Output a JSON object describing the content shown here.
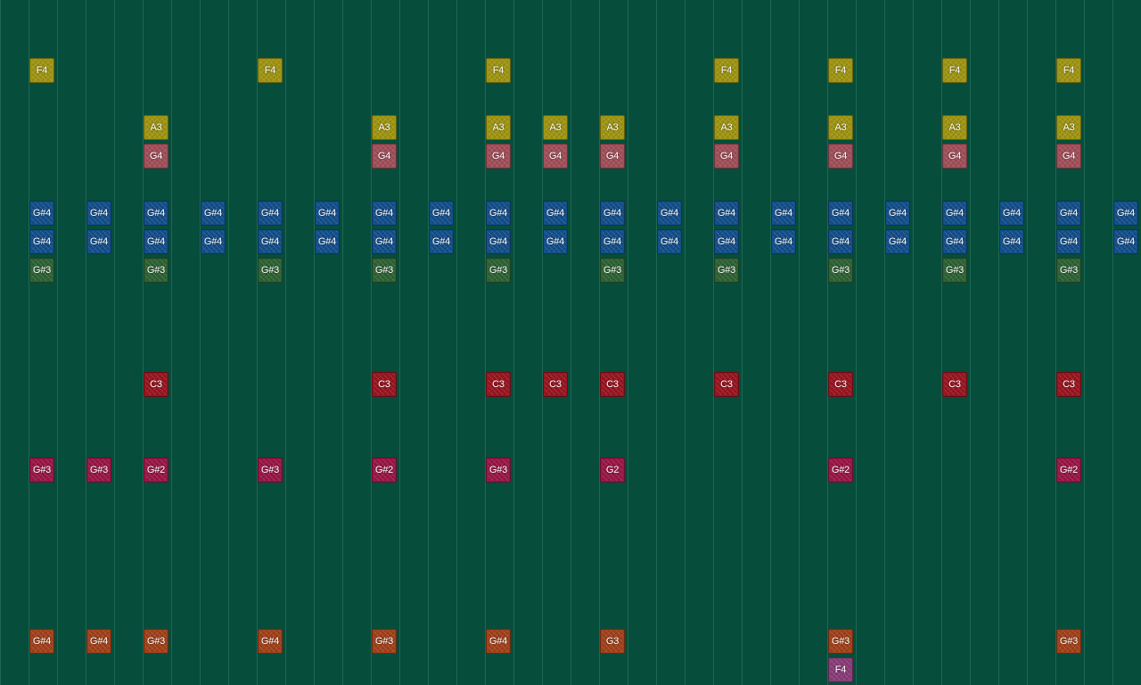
{
  "view": {
    "columns": 40,
    "track_colors": {
      "track_1": "#9f9512",
      "track_2": "#9f9512",
      "track_3": "#a24f59",
      "track_4": "#134f8b",
      "track_5": "#134f8b",
      "track_6": "#2d6334",
      "track_7": "#9a1520",
      "track_8": "#9b1646",
      "track_9": "#a2411a",
      "track_10": "#8a3c79"
    }
  },
  "notes": [
    {
      "label": "F4",
      "track": 1,
      "col": 1
    },
    {
      "label": "F4",
      "track": 1,
      "col": 9
    },
    {
      "label": "F4",
      "track": 1,
      "col": 17
    },
    {
      "label": "F4",
      "track": 1,
      "col": 25
    },
    {
      "label": "F4",
      "track": 1,
      "col": 29
    },
    {
      "label": "F4",
      "track": 1,
      "col": 33
    },
    {
      "label": "F4",
      "track": 1,
      "col": 37
    },
    {
      "label": "A3",
      "track": 2,
      "col": 5
    },
    {
      "label": "A3",
      "track": 2,
      "col": 13
    },
    {
      "label": "A3",
      "track": 2,
      "col": 17
    },
    {
      "label": "A3",
      "track": 2,
      "col": 19
    },
    {
      "label": "A3",
      "track": 2,
      "col": 21
    },
    {
      "label": "A3",
      "track": 2,
      "col": 25
    },
    {
      "label": "A3",
      "track": 2,
      "col": 29
    },
    {
      "label": "A3",
      "track": 2,
      "col": 33
    },
    {
      "label": "A3",
      "track": 2,
      "col": 37
    },
    {
      "label": "G4",
      "track": 3,
      "col": 5
    },
    {
      "label": "G4",
      "track": 3,
      "col": 13
    },
    {
      "label": "G4",
      "track": 3,
      "col": 17
    },
    {
      "label": "G4",
      "track": 3,
      "col": 19
    },
    {
      "label": "G4",
      "track": 3,
      "col": 21
    },
    {
      "label": "G4",
      "track": 3,
      "col": 25
    },
    {
      "label": "G4",
      "track": 3,
      "col": 29
    },
    {
      "label": "G4",
      "track": 3,
      "col": 33
    },
    {
      "label": "G4",
      "track": 3,
      "col": 37
    },
    {
      "label": "G#4",
      "track": 4,
      "col": 1
    },
    {
      "label": "G#4",
      "track": 4,
      "col": 3
    },
    {
      "label": "G#4",
      "track": 4,
      "col": 5
    },
    {
      "label": "G#4",
      "track": 4,
      "col": 7
    },
    {
      "label": "G#4",
      "track": 4,
      "col": 9
    },
    {
      "label": "G#4",
      "track": 4,
      "col": 11
    },
    {
      "label": "G#4",
      "track": 4,
      "col": 13
    },
    {
      "label": "G#4",
      "track": 4,
      "col": 15
    },
    {
      "label": "G#4",
      "track": 4,
      "col": 17
    },
    {
      "label": "G#4",
      "track": 4,
      "col": 19
    },
    {
      "label": "G#4",
      "track": 4,
      "col": 21
    },
    {
      "label": "G#4",
      "track": 4,
      "col": 23
    },
    {
      "label": "G#4",
      "track": 4,
      "col": 25
    },
    {
      "label": "G#4",
      "track": 4,
      "col": 27
    },
    {
      "label": "G#4",
      "track": 4,
      "col": 29
    },
    {
      "label": "G#4",
      "track": 4,
      "col": 31
    },
    {
      "label": "G#4",
      "track": 4,
      "col": 33
    },
    {
      "label": "G#4",
      "track": 4,
      "col": 35
    },
    {
      "label": "G#4",
      "track": 4,
      "col": 37
    },
    {
      "label": "G#4",
      "track": 4,
      "col": 39
    },
    {
      "label": "G#4",
      "track": 5,
      "col": 1
    },
    {
      "label": "G#4",
      "track": 5,
      "col": 3
    },
    {
      "label": "G#4",
      "track": 5,
      "col": 5
    },
    {
      "label": "G#4",
      "track": 5,
      "col": 7
    },
    {
      "label": "G#4",
      "track": 5,
      "col": 9
    },
    {
      "label": "G#4",
      "track": 5,
      "col": 11
    },
    {
      "label": "G#4",
      "track": 5,
      "col": 13
    },
    {
      "label": "G#4",
      "track": 5,
      "col": 15
    },
    {
      "label": "G#4",
      "track": 5,
      "col": 17
    },
    {
      "label": "G#4",
      "track": 5,
      "col": 19
    },
    {
      "label": "G#4",
      "track": 5,
      "col": 21
    },
    {
      "label": "G#4",
      "track": 5,
      "col": 23
    },
    {
      "label": "G#4",
      "track": 5,
      "col": 25
    },
    {
      "label": "G#4",
      "track": 5,
      "col": 27
    },
    {
      "label": "G#4",
      "track": 5,
      "col": 29
    },
    {
      "label": "G#4",
      "track": 5,
      "col": 31
    },
    {
      "label": "G#4",
      "track": 5,
      "col": 33
    },
    {
      "label": "G#4",
      "track": 5,
      "col": 35
    },
    {
      "label": "G#4",
      "track": 5,
      "col": 37
    },
    {
      "label": "G#4",
      "track": 5,
      "col": 39
    },
    {
      "label": "G#3",
      "track": 6,
      "col": 1
    },
    {
      "label": "G#3",
      "track": 6,
      "col": 5
    },
    {
      "label": "G#3",
      "track": 6,
      "col": 9
    },
    {
      "label": "G#3",
      "track": 6,
      "col": 13
    },
    {
      "label": "G#3",
      "track": 6,
      "col": 17
    },
    {
      "label": "G#3",
      "track": 6,
      "col": 21
    },
    {
      "label": "G#3",
      "track": 6,
      "col": 25
    },
    {
      "label": "G#3",
      "track": 6,
      "col": 29
    },
    {
      "label": "G#3",
      "track": 6,
      "col": 33
    },
    {
      "label": "G#3",
      "track": 6,
      "col": 37
    },
    {
      "label": "C3",
      "track": 7,
      "col": 5
    },
    {
      "label": "C3",
      "track": 7,
      "col": 13
    },
    {
      "label": "C3",
      "track": 7,
      "col": 17
    },
    {
      "label": "C3",
      "track": 7,
      "col": 19
    },
    {
      "label": "C3",
      "track": 7,
      "col": 21
    },
    {
      "label": "C3",
      "track": 7,
      "col": 25
    },
    {
      "label": "C3",
      "track": 7,
      "col": 29
    },
    {
      "label": "C3",
      "track": 7,
      "col": 33
    },
    {
      "label": "C3",
      "track": 7,
      "col": 37
    },
    {
      "label": "G#3",
      "track": 8,
      "col": 1
    },
    {
      "label": "G#3",
      "track": 8,
      "col": 3
    },
    {
      "label": "G#2",
      "track": 8,
      "col": 5
    },
    {
      "label": "G#3",
      "track": 8,
      "col": 9
    },
    {
      "label": "G#2",
      "track": 8,
      "col": 13
    },
    {
      "label": "G#3",
      "track": 8,
      "col": 17
    },
    {
      "label": "G2",
      "track": 8,
      "col": 21
    },
    {
      "label": "G#2",
      "track": 8,
      "col": 29
    },
    {
      "label": "G#2",
      "track": 8,
      "col": 37
    },
    {
      "label": "G#4",
      "track": 9,
      "col": 1
    },
    {
      "label": "G#4",
      "track": 9,
      "col": 3
    },
    {
      "label": "G#3",
      "track": 9,
      "col": 5
    },
    {
      "label": "G#4",
      "track": 9,
      "col": 9
    },
    {
      "label": "G#3",
      "track": 9,
      "col": 13
    },
    {
      "label": "G#4",
      "track": 9,
      "col": 17
    },
    {
      "label": "G3",
      "track": 9,
      "col": 21
    },
    {
      "label": "G#3",
      "track": 9,
      "col": 29
    },
    {
      "label": "G#3",
      "track": 9,
      "col": 37
    },
    {
      "label": "F4",
      "track": 10,
      "col": 29
    }
  ]
}
